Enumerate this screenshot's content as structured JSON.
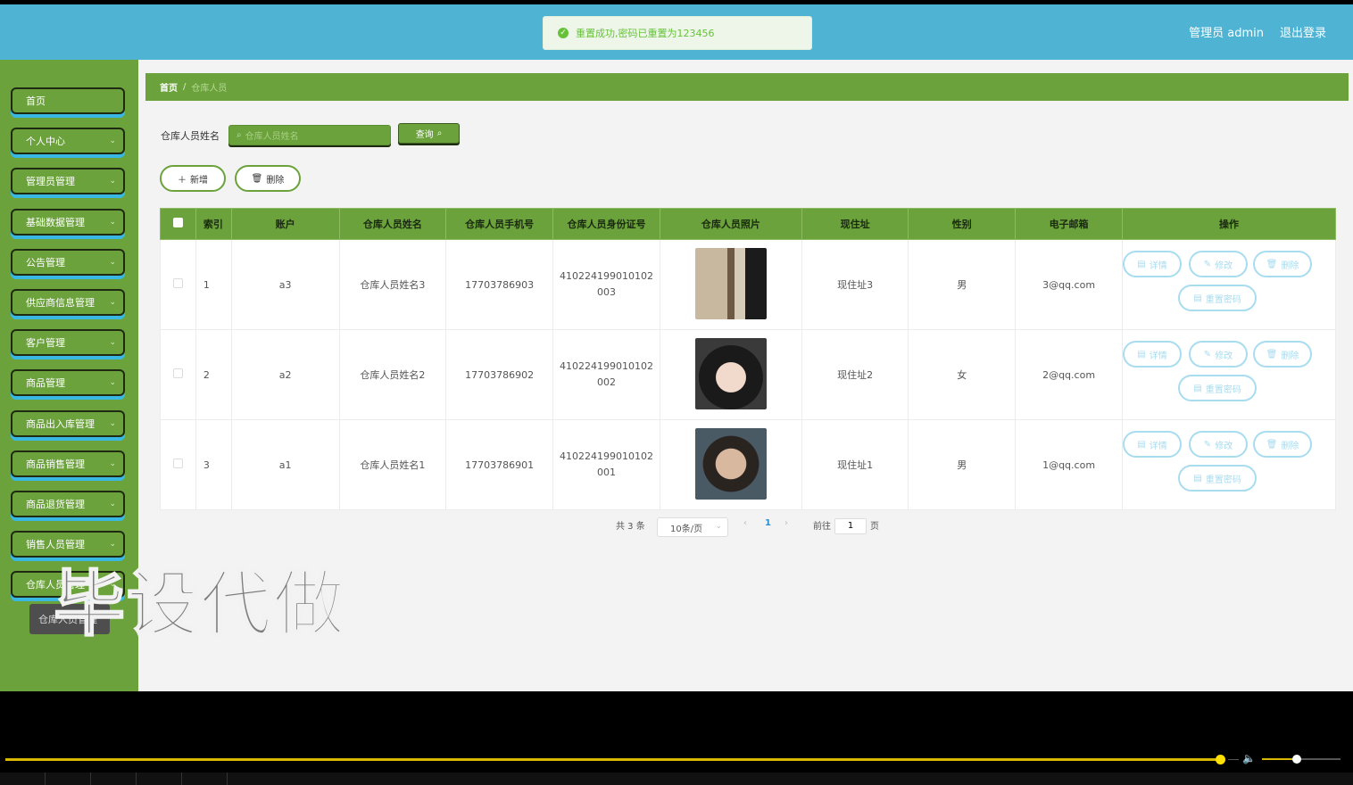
{
  "toast": {
    "message": "重置成功,密码已重置为123456"
  },
  "header": {
    "user": "管理员 admin",
    "logout": "退出登录"
  },
  "sidebar": {
    "items": [
      {
        "label": "首页",
        "has_children": false
      },
      {
        "label": "个人中心",
        "has_children": true
      },
      {
        "label": "管理员管理",
        "has_children": true
      },
      {
        "label": "基础数据管理",
        "has_children": true
      },
      {
        "label": "公告管理",
        "has_children": true
      },
      {
        "label": "供应商信息管理",
        "has_children": true
      },
      {
        "label": "客户管理",
        "has_children": true
      },
      {
        "label": "商品管理",
        "has_children": true
      },
      {
        "label": "商品出入库管理",
        "has_children": true
      },
      {
        "label": "商品销售管理",
        "has_children": true
      },
      {
        "label": "商品退货管理",
        "has_children": true
      },
      {
        "label": "销售人员管理",
        "has_children": true
      },
      {
        "label": "仓库人员管理",
        "has_children": true
      }
    ],
    "submenu_item": "仓库人员管理"
  },
  "watermark": "毕设代做",
  "breadcrumb": {
    "home": "首页",
    "separator": "/",
    "current": "仓库人员"
  },
  "search": {
    "label": "仓库人员姓名",
    "placeholder": "仓库人员姓名",
    "button": "查询"
  },
  "actions": {
    "add": "新增",
    "delete": "删除"
  },
  "table": {
    "columns": [
      "索引",
      "账户",
      "仓库人员姓名",
      "仓库人员手机号",
      "仓库人员身份证号",
      "仓库人员照片",
      "现住址",
      "性别",
      "电子邮箱",
      "操作"
    ],
    "rows": [
      {
        "index": "1",
        "account": "a3",
        "name": "仓库人员姓名3",
        "phone": "17703786903",
        "id_line1": "410224199010102",
        "id_line2": "003",
        "photo": "photo-3",
        "address": "现住址3",
        "gender": "男",
        "email": "3@qq.com"
      },
      {
        "index": "2",
        "account": "a2",
        "name": "仓库人员姓名2",
        "phone": "17703786902",
        "id_line1": "410224199010102",
        "id_line2": "002",
        "photo": "photo-2",
        "address": "现住址2",
        "gender": "女",
        "email": "2@qq.com"
      },
      {
        "index": "3",
        "account": "a1",
        "name": "仓库人员姓名1",
        "phone": "17703786901",
        "id_line1": "410224199010102",
        "id_line2": "001",
        "photo": "photo-1",
        "address": "现住址1",
        "gender": "男",
        "email": "1@qq.com"
      }
    ],
    "row_actions": {
      "detail": "详情",
      "edit": "修改",
      "delete": "删除",
      "reset": "重置密码"
    }
  },
  "pagination": {
    "total": "共 3 条",
    "page_size": "10条/页",
    "current_page": "1",
    "goto_prefix": "前往",
    "goto_value": "1",
    "goto_suffix": "页"
  },
  "player": {
    "progress": 0.995,
    "volume": 0.45,
    "accent": "#ffe000"
  }
}
